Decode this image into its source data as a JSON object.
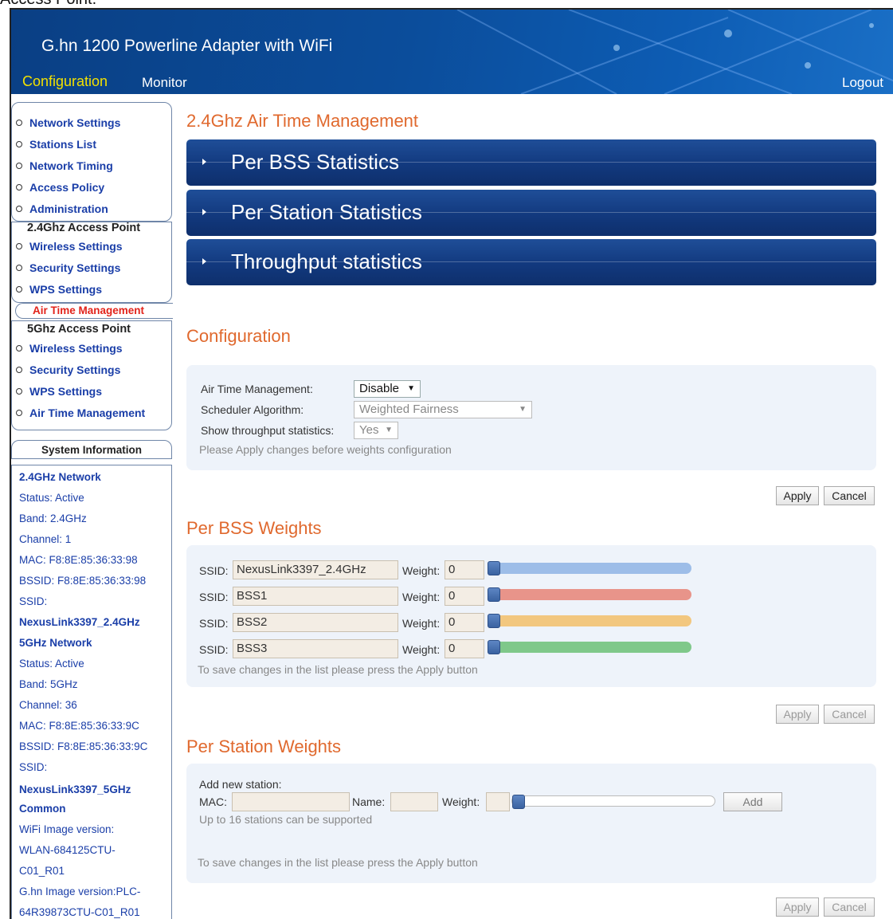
{
  "caption": "Access Point.",
  "header": {
    "title": "G.hn 1200 Powerline Adapter with WiFi",
    "nav": {
      "configuration": "Configuration",
      "monitor": "Monitor",
      "logout": "Logout"
    }
  },
  "sidebar": {
    "general": [
      "Network Settings",
      "Stations List",
      "Network Timing",
      "Access Policy",
      "Administration"
    ],
    "ap24": {
      "heading": "2.4Ghz Access Point",
      "items": [
        "Wireless Settings",
        "Security Settings",
        "WPS Settings"
      ],
      "active": "Air Time Management"
    },
    "ap5": {
      "heading": "5Ghz Access Point",
      "items": [
        "Wireless Settings",
        "Security Settings",
        "WPS Settings",
        "Air Time Management"
      ]
    }
  },
  "system_info": {
    "title": "System Information",
    "lines": [
      "2.4GHz Network",
      "Status: Active",
      "Band: 2.4GHz",
      "Channel: 1",
      "MAC: F8:8E:85:36:33:98",
      "BSSID: F8:8E:85:36:33:98",
      "SSID:",
      "NexusLink3397_2.4GHz",
      "5GHz Network",
      "Status: Active",
      "Band: 5GHz",
      "Channel: 36",
      "MAC: F8:8E:85:36:33:9C",
      "BSSID: F8:8E:85:36:33:9C",
      "SSID:",
      "NexusLink3397_5GHz",
      "Common",
      "WiFi Image version:",
      "WLAN-684125CTU-",
      "C01_R01",
      "G.hn Image version:PLC-",
      "64R39873CTU-C01_R01"
    ]
  },
  "main": {
    "title": "2.4Ghz Air Time Management",
    "accordions": [
      "Per BSS Statistics",
      "Per Station Statistics",
      "Throughput statistics"
    ],
    "configuration": {
      "title": "Configuration",
      "atm_label": "Air Time Management:",
      "atm_value": "Disable",
      "scheduler_label": "Scheduler Algorithm:",
      "scheduler_value": "Weighted Fairness",
      "throughput_label": "Show throughput statistics:",
      "throughput_value": "Yes",
      "note": "Please Apply changes before weights configuration",
      "apply": "Apply",
      "cancel": "Cancel"
    },
    "bss_weights": {
      "title": "Per BSS Weights",
      "ssid_label": "SSID:",
      "weight_label": "Weight:",
      "rows": [
        {
          "ssid": "NexusLink3397_2.4GHz",
          "weight": "0",
          "color": "#9dbde8"
        },
        {
          "ssid": "BSS1",
          "weight": "0",
          "color": "#e8948a"
        },
        {
          "ssid": "BSS2",
          "weight": "0",
          "color": "#f2c77f"
        },
        {
          "ssid": "BSS3",
          "weight": "0",
          "color": "#7fc88a"
        }
      ],
      "note": "To save changes in the list please press the Apply button",
      "apply": "Apply",
      "cancel": "Cancel"
    },
    "station_weights": {
      "title": "Per Station Weights",
      "add_label": "Add new station:",
      "mac_label": "MAC:",
      "name_label": "Name:",
      "weight_label": "Weight:",
      "add_button": "Add",
      "limit_note": "Up to 16 stations can be supported",
      "note": "To save changes in the list please press the Apply button",
      "apply": "Apply",
      "cancel": "Cancel"
    }
  }
}
